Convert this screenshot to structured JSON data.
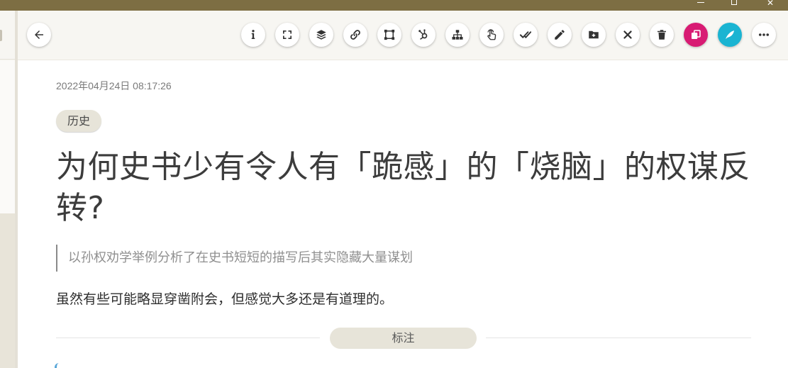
{
  "window": {
    "minimize_icon": "minimize-icon",
    "maximize_icon": "restore-icon",
    "close_glyph": "✕"
  },
  "toolbar": {
    "buttons": [
      {
        "name": "back-button",
        "icon": "arrow-left-icon"
      },
      {
        "name": "info-button",
        "icon": "info-icon"
      },
      {
        "name": "fullscreen-button",
        "icon": "fullscreen-icon"
      },
      {
        "name": "layers-button",
        "icon": "layers-icon"
      },
      {
        "name": "link-button",
        "icon": "link-icon"
      },
      {
        "name": "select-area-button",
        "icon": "vector-square-icon"
      },
      {
        "name": "branch-button",
        "icon": "hubspot-icon"
      },
      {
        "name": "sitemap-button",
        "icon": "sitemap-icon"
      },
      {
        "name": "pointer-button",
        "icon": "hand-pointer-icon"
      },
      {
        "name": "done-all-button",
        "icon": "double-check-icon"
      },
      {
        "name": "edit-button",
        "icon": "pencil-icon"
      },
      {
        "name": "add-to-folder-button",
        "icon": "folder-plus-icon"
      },
      {
        "name": "close-button",
        "icon": "close-icon"
      },
      {
        "name": "delete-button",
        "icon": "trash-icon"
      },
      {
        "name": "copy-button",
        "icon": "copy-icon",
        "color": "#d81b73"
      },
      {
        "name": "feather-button",
        "icon": "feather-icon",
        "color": "#1ab4d2"
      },
      {
        "name": "more-button",
        "icon": "more-horizontal-icon"
      }
    ]
  },
  "article": {
    "date": "2022年04月24日 08:17:26",
    "tag": "历史",
    "title": "为何史书少有令人有「跪感」的「烧脑」的权谋反转?",
    "summary": "以孙权劝学举例分析了在史书短短的描写后其实隐藏大量谋划",
    "body": "虽然有些可能略显穿凿附会，但感觉大多还是有道理的。",
    "annotation_label": "标注"
  },
  "colors": {
    "titlebar": "#7d6e43",
    "pink_accent": "#d81b73",
    "teal_accent": "#1ab4d2",
    "tag_bg": "#e7e4d9"
  }
}
